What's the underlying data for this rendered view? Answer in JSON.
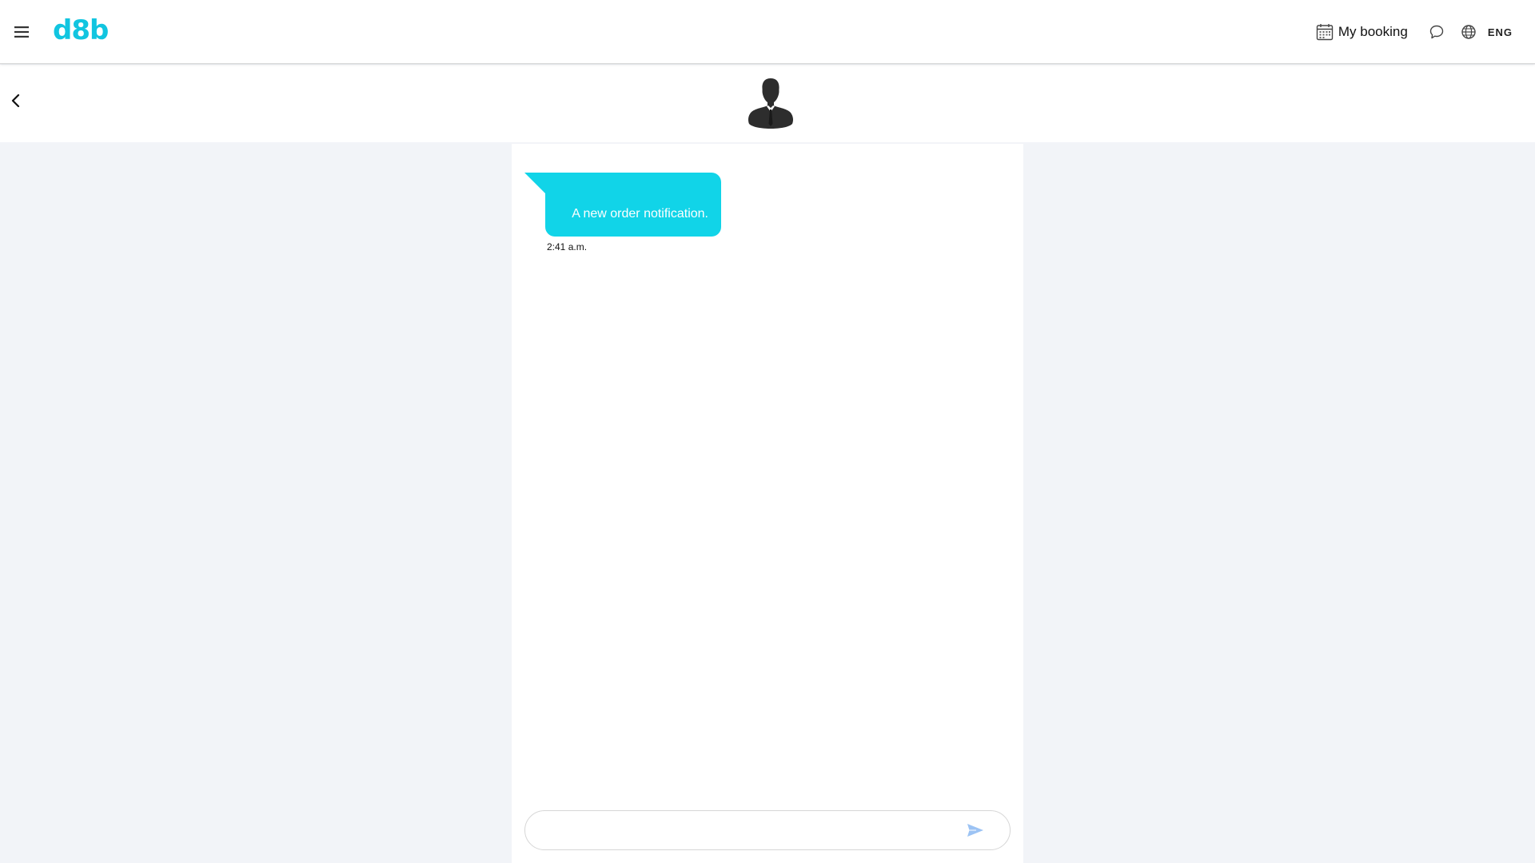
{
  "header": {
    "logo_text": "d8b",
    "menu_icon": "hamburger-menu-icon",
    "booking_icon": "calendar-icon",
    "booking_label": "My booking",
    "chat_icon": "chat-bubble-icon",
    "language_icon": "globe-icon",
    "language_label": "ENG"
  },
  "chat_header": {
    "back_icon": "chevron-left-icon",
    "avatar_icon": "user-silhouette-icon"
  },
  "messages": [
    {
      "text": "A new order notification.",
      "time": "2:41 a.m."
    }
  ],
  "composer": {
    "value": "",
    "placeholder": "",
    "send_icon": "send-icon"
  },
  "colors": {
    "brand": "#11c5e0",
    "bubble": "#11d4e8",
    "page_background": "#f2f4f8",
    "send_icon": "#9cc3f4"
  }
}
